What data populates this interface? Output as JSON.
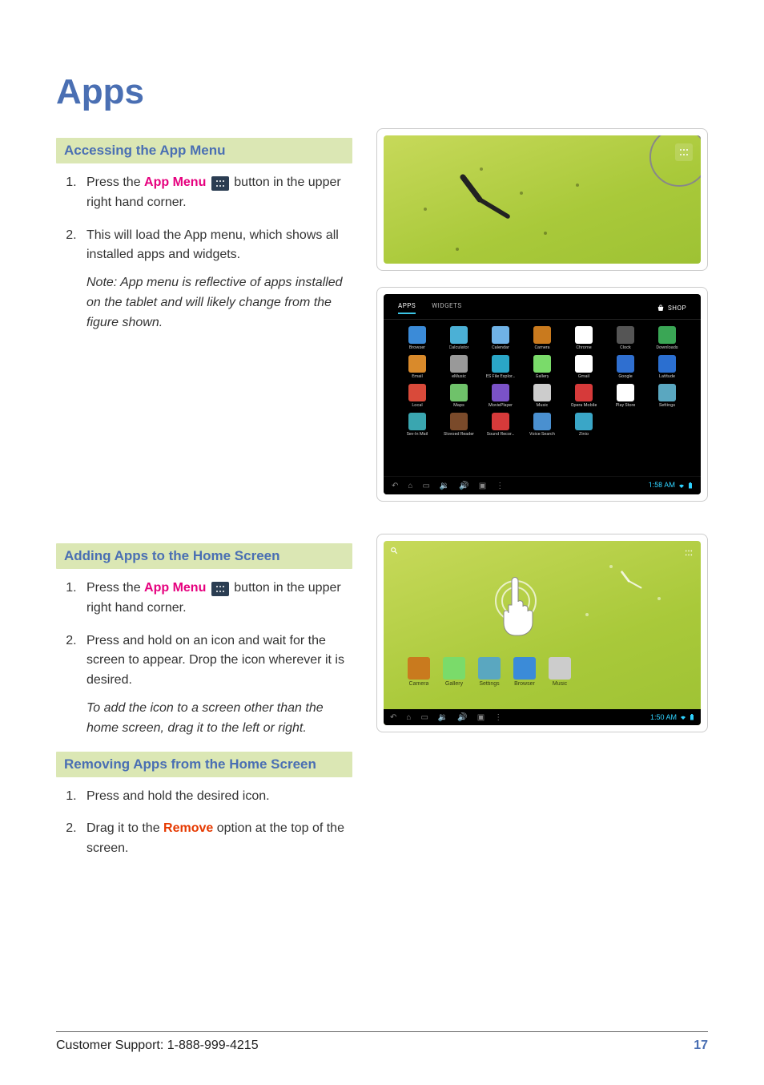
{
  "page": {
    "title": "Apps",
    "number": "17"
  },
  "footer": {
    "support": "Customer Support: 1-888-999-4215"
  },
  "sections": {
    "accessing": {
      "header": "Accessing the App Menu",
      "step1_pre": "Press the ",
      "step1_label": "App Menu",
      "step1_post": " button in the upper right hand corner.",
      "step2": "This will load the App menu, which shows all installed apps and widgets.",
      "note": "Note: App menu is reflective of apps installed on the tablet and will likely change from the figure shown."
    },
    "adding": {
      "header": "Adding Apps to the Home Screen",
      "step1_pre": "Press the ",
      "step1_label": "App Menu",
      "step1_post": " button in the upper right hand corner.",
      "step2": "Press and hold on an icon and wait for the screen to appear. Drop the icon wherever it is desired.",
      "tip": "To add the icon to a screen other than the home screen, drag it to the left or right."
    },
    "removing": {
      "header": "Removing Apps from the Home Screen",
      "step1": "Press and hold the desired icon.",
      "step2_pre": "Drag it to the ",
      "step2_label": "Remove",
      "step2_post": " option at the top of the screen."
    }
  },
  "drawer": {
    "tabs": {
      "apps": "APPS",
      "widgets": "WIDGETS"
    },
    "shop": "SHOP",
    "time": "1:58 AM",
    "apps": [
      {
        "label": "Browser",
        "bg": "#3b8bd8"
      },
      {
        "label": "Calculator",
        "bg": "#4bb0d6"
      },
      {
        "label": "Calendar",
        "bg": "#6fb2e6"
      },
      {
        "label": "Camera",
        "bg": "#c97a1e"
      },
      {
        "label": "Chrome",
        "bg": "#ffffff"
      },
      {
        "label": "Clock",
        "bg": "#555555"
      },
      {
        "label": "Downloads",
        "bg": "#3aa655"
      },
      {
        "label": "Email",
        "bg": "#d98a2b"
      },
      {
        "label": "eMusic",
        "bg": "#999999"
      },
      {
        "label": "ES File Explor…",
        "bg": "#2aa6c7"
      },
      {
        "label": "Gallery",
        "bg": "#7adb6a"
      },
      {
        "label": "Gmail",
        "bg": "#ffffff"
      },
      {
        "label": "Google",
        "bg": "#2f6fd0"
      },
      {
        "label": "Latitude",
        "bg": "#2b6fd0"
      },
      {
        "label": "Local",
        "bg": "#d94a3a"
      },
      {
        "label": "Maps",
        "bg": "#6fc26a"
      },
      {
        "label": "MoviePlayer",
        "bg": "#7a52c7"
      },
      {
        "label": "Music",
        "bg": "#cccccc"
      },
      {
        "label": "Opera Mobile",
        "bg": "#d63a3a"
      },
      {
        "label": "Play Store",
        "bg": "#ffffff"
      },
      {
        "label": "Settings",
        "bg": "#5aa7c0"
      },
      {
        "label": "Sev-In Mail",
        "bg": "#3aa6b0"
      },
      {
        "label": "Slovoed Reader",
        "bg": "#7a4a2a"
      },
      {
        "label": "Sound Recor…",
        "bg": "#d63a3a"
      },
      {
        "label": "Voice Search",
        "bg": "#4a90d0"
      },
      {
        "label": "Zinio",
        "bg": "#3aa6c7"
      }
    ]
  },
  "home2": {
    "time": "1:50 AM",
    "dock": [
      {
        "label": "Camera",
        "bg": "#c97a1e"
      },
      {
        "label": "Gallery",
        "bg": "#7adb6a"
      },
      {
        "label": "Settings",
        "bg": "#5aa7c0"
      },
      {
        "label": "Browser",
        "bg": "#3b8bd8"
      },
      {
        "label": "Music",
        "bg": "#cccccc"
      }
    ]
  }
}
